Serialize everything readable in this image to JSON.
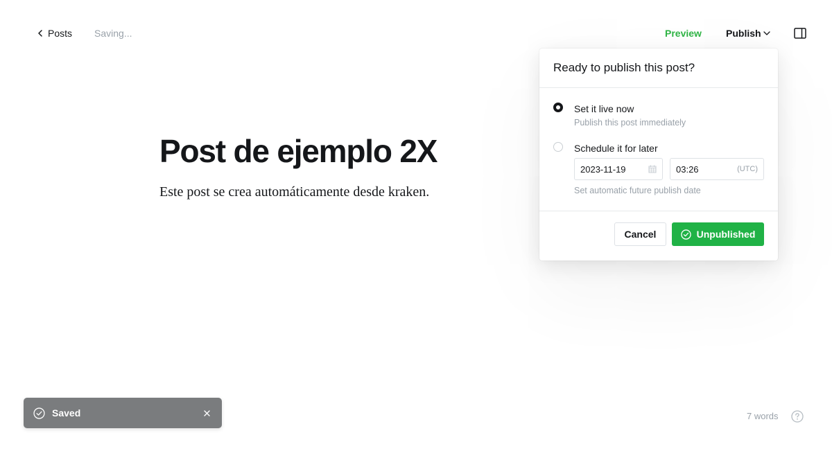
{
  "topbar": {
    "back_label": "Posts",
    "status": "Saving...",
    "preview_label": "Preview",
    "publish_label": "Publish"
  },
  "post": {
    "title": "Post de ejemplo 2X",
    "body": "Este post se crea automáticamente desde kraken."
  },
  "publish_panel": {
    "header": "Ready to publish this post?",
    "options": [
      {
        "label": "Set it live now",
        "description": "Publish this post immediately",
        "selected": true
      },
      {
        "label": "Schedule it for later",
        "description": "Set automatic future publish date",
        "selected": false
      }
    ],
    "schedule": {
      "date": "2023-11-19",
      "time": "03:26",
      "timezone": "(UTC)"
    },
    "cancel_label": "Cancel",
    "confirm_label": "Unpublished"
  },
  "toast": {
    "message": "Saved"
  },
  "footer": {
    "word_count": "7 words"
  },
  "colors": {
    "accent_green": "#20b246",
    "preview_green": "#2fb445",
    "muted": "#99a1a9",
    "toast_bg": "#7a7c7e"
  }
}
